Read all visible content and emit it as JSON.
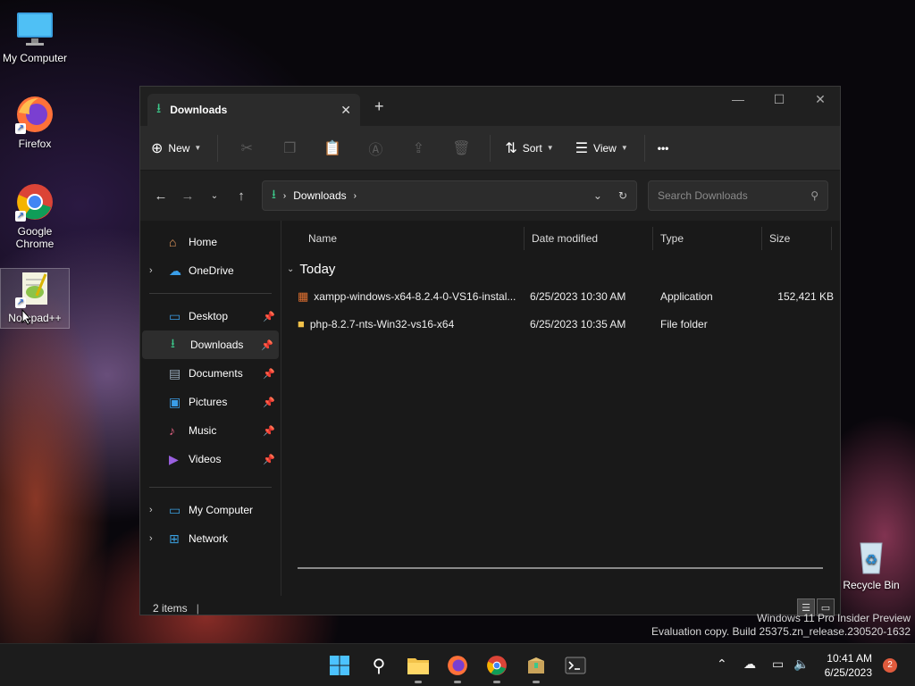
{
  "desktop": {
    "icons": [
      {
        "label": "My Computer",
        "icon": "monitor-icon"
      },
      {
        "label": "Firefox",
        "icon": "firefox-icon"
      },
      {
        "label": "Google Chrome",
        "icon": "chrome-icon"
      },
      {
        "label": "Notepad++",
        "icon": "notepad-plus-plus-icon"
      },
      {
        "label": "Recycle Bin",
        "icon": "recycle-bin-icon"
      }
    ]
  },
  "window": {
    "tab_title": "Downloads",
    "command_bar": {
      "new_label": "New",
      "sort_label": "Sort",
      "view_label": "View",
      "more_label": "•••"
    },
    "address": {
      "crumb": "Downloads"
    },
    "search": {
      "placeholder": "Search Downloads"
    },
    "sidebar": {
      "items": [
        {
          "label": "Home"
        },
        {
          "label": "OneDrive"
        },
        {
          "label": "Desktop"
        },
        {
          "label": "Downloads"
        },
        {
          "label": "Documents"
        },
        {
          "label": "Pictures"
        },
        {
          "label": "Music"
        },
        {
          "label": "Videos"
        },
        {
          "label": "My Computer"
        },
        {
          "label": "Network"
        }
      ]
    },
    "columns": {
      "name": "Name",
      "date": "Date modified",
      "type": "Type",
      "size": "Size"
    },
    "group": "Today",
    "files": [
      {
        "name": "xampp-windows-x64-8.2.4-0-VS16-instal...",
        "date": "6/25/2023 10:30 AM",
        "type": "Application",
        "size": "152,421 KB"
      },
      {
        "name": "php-8.2.7-nts-Win32-vs16-x64",
        "date": "6/25/2023 10:35 AM",
        "type": "File folder",
        "size": ""
      }
    ],
    "status": "2 items"
  },
  "watermark": {
    "line1": "Windows 11 Pro Insider Preview",
    "line2": "Evaluation copy. Build 25375.zn_release.230520-1632"
  },
  "taskbar": {
    "time": "10:41 AM",
    "date": "6/25/2023",
    "notifications": "2"
  }
}
